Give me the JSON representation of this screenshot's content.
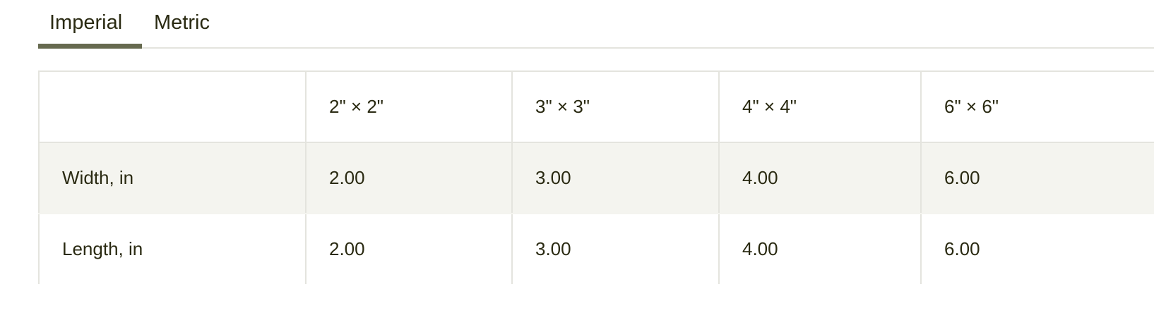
{
  "tabs": [
    {
      "label": "Imperial",
      "active": true
    },
    {
      "label": "Metric",
      "active": false
    }
  ],
  "colors": {
    "text": "#2a2a12",
    "active_underline": "#666a4f",
    "border": "#e4e4de",
    "shaded_row": "#f4f4ef"
  },
  "table": {
    "headers": [
      "",
      "2\" × 2\"",
      "3\" × 3\"",
      "4\" × 4\"",
      "6\" × 6\""
    ],
    "rows": [
      {
        "label": "Width, in",
        "values": [
          "2.00",
          "3.00",
          "4.00",
          "6.00"
        ]
      },
      {
        "label": "Length, in",
        "values": [
          "2.00",
          "3.00",
          "4.00",
          "6.00"
        ]
      }
    ]
  }
}
